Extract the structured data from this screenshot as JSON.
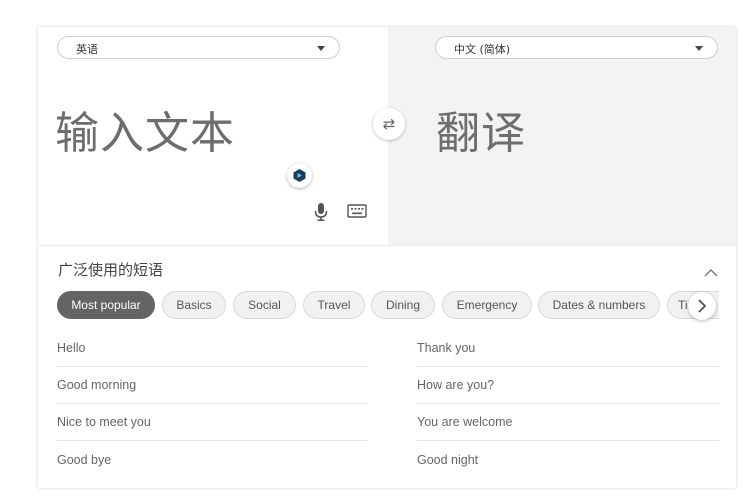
{
  "source": {
    "language": "英语",
    "placeholder": "输入文本"
  },
  "target": {
    "language": "中文 (简体)",
    "placeholder": "翻译"
  },
  "icons": {
    "swap": "⇄"
  },
  "phrases": {
    "title": "广泛使用的短语",
    "categories": [
      {
        "label": "Most popular",
        "active": true
      },
      {
        "label": "Basics"
      },
      {
        "label": "Social"
      },
      {
        "label": "Travel"
      },
      {
        "label": "Dining"
      },
      {
        "label": "Emergency"
      },
      {
        "label": "Dates & numbers"
      },
      {
        "label": "Time"
      }
    ],
    "left": [
      "Hello",
      "Good morning",
      "Nice to meet you",
      "Good bye"
    ],
    "right": [
      "Thank you",
      "How are you?",
      "You are welcome",
      "Good night"
    ]
  },
  "colors": {
    "active_chip": "#646464",
    "copilot_badge": "#1b3a5c"
  }
}
